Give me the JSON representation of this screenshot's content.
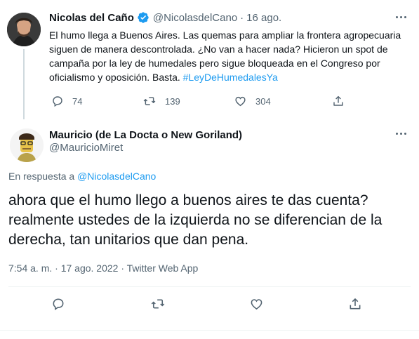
{
  "tweet1": {
    "name": "Nicolas del Caño",
    "handle": "@NicolasdelCano",
    "separator": "·",
    "time": "16 ago.",
    "text": "El humo llega a Buenos Aires. Las quemas para ampliar la frontera agropecuaria siguen de manera descontrolada. ¿No van a hacer nada? Hicieron un spot de campaña por la ley de humedales pero sigue bloqueada en el Congreso por oficialismo y oposición. Basta. ",
    "hashtag": "#LeyDeHumedalesYa",
    "replies": "74",
    "retweets": "139",
    "likes": "304"
  },
  "tweet2": {
    "name": "Mauricio (de La Docta o New Goriland)",
    "handle": "@MauricioMiret",
    "reply_prefix": "En respuesta a ",
    "reply_to": "@NicolasdelCano",
    "text": "ahora que el humo llego a buenos aires te das cuenta? realmente ustedes de la izquierda no se diferencian de la derecha, tan unitarios que dan pena.",
    "timestamp": "7:54 a. m. · 17 ago. 2022 · Twitter Web App"
  },
  "colors": {
    "accent": "#1d9bf0",
    "muted": "#536471",
    "text": "#0f1419",
    "border": "#eff3f4"
  },
  "icons": [
    "verified-badge-icon",
    "reply-icon",
    "retweet-icon",
    "like-icon",
    "share-icon",
    "more-icon"
  ]
}
